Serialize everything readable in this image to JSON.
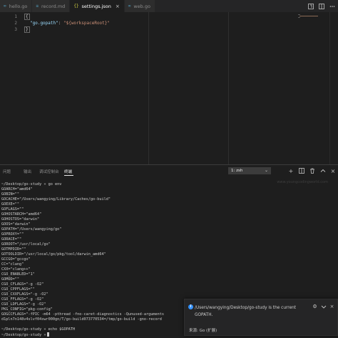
{
  "tabs": [
    {
      "label": "hello.go",
      "icon": "go-file-icon",
      "glyph": "∞",
      "active": false
    },
    {
      "label": "record.md",
      "icon": "markdown-file-icon",
      "glyph": "≡",
      "active": false
    },
    {
      "label": "settings.json",
      "icon": "json-file-icon",
      "glyph": "{}",
      "active": true
    },
    {
      "label": "web.go",
      "icon": "go-file-icon",
      "glyph": "∞",
      "active": false
    }
  ],
  "tab_close_glyph": "×",
  "editor": {
    "line_numbers": [
      "1",
      "2",
      "3"
    ],
    "line1": "{",
    "key": "\"go.gopath\"",
    "colon": ": ",
    "value": "\"${workspaceRoot}\"",
    "line3": "}"
  },
  "panel": {
    "tabs": [
      "问题",
      "输出",
      "调试控制台",
      "终端"
    ],
    "terminal_selector": "1: zsh",
    "watermark": "www.youngcodingworld.com"
  },
  "terminal_lines": [
    "~/Desktop/go-study » go env",
    "GOARCH=\"amd64\"",
    "GOBIN=\"\"",
    "GOCACHE=\"/Users/wangying/Library/Caches/go-build\"",
    "GOEXE=\"\"",
    "GOFLAGS=\"\"",
    "GOHOSTARCH=\"amd64\"",
    "GOHOSTOS=\"darwin\"",
    "GOOS=\"darwin\"",
    "GOPATH=\"/Users/wangying/go\"",
    "GOPROXY=\"\"",
    "GORACE=\"\"",
    "GOROOT=\"/usr/local/go\"",
    "GOTMPDIR=\"\"",
    "GOTOOLDIR=\"/usr/local/go/pkg/tool/darwin_amd64\"",
    "GCCGO=\"gccgo\"",
    "CC=\"clang\"",
    "CXX=\"clang++\"",
    "CGO_ENABLED=\"1\"",
    "GOMOD=\"\"",
    "CGO_CFLAGS=\"-g -O2\"",
    "CGO_CPPFLAGS=\"\"",
    "CGO_CXXFLAGS=\"-g -O2\"",
    "CGO_FFLAGS=\"-g -O2\"",
    "CGO_LDFLAGS=\"-g -O2\"",
    "PKG_CONFIG=\"pkg-config\"",
    "GOGCCFLAGS=\"-fPIC -m64 -pthread -fno-caret-diagnostics -Qunused-arguments",
    "d1pln7n148v4slvf04swr000gn/T/go-build073770534=/tmp/go-build -gno-record",
    "",
    "~/Desktop/go-study » echo $GOPATH"
  ],
  "prompt_line": "~/Desktop/go-study »",
  "notification": {
    "message": "/Users/wangying/Desktop/go-study is the current GOPATH.",
    "source": "来源: Go (扩展)"
  }
}
